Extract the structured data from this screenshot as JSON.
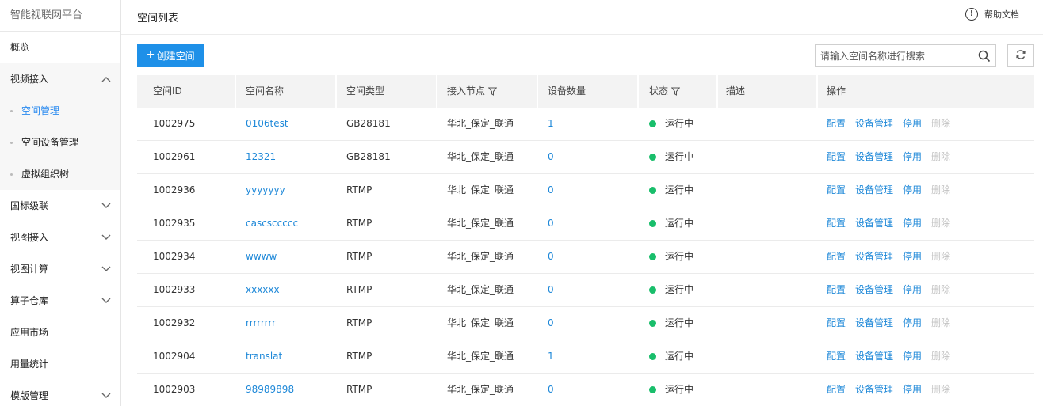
{
  "sidebar": {
    "brand": "智能视联网平台",
    "overview": "概览",
    "video_access": {
      "label": "视频接入",
      "children": [
        "空间管理",
        "空间设备管理",
        "虚拟组织树"
      ],
      "active_index": 0
    },
    "items": [
      {
        "label": "国标级联",
        "expandable": true
      },
      {
        "label": "视图接入",
        "expandable": true
      },
      {
        "label": "视图计算",
        "expandable": true
      },
      {
        "label": "算子仓库",
        "expandable": true
      },
      {
        "label": "应用市场",
        "expandable": false
      },
      {
        "label": "用量统计",
        "expandable": false
      },
      {
        "label": "模版管理",
        "expandable": true
      }
    ]
  },
  "header": {
    "title": "空间列表",
    "help_label": "帮助文档"
  },
  "toolbar": {
    "create_label": "创建空间",
    "search_placeholder": "请输入空间名称进行搜索"
  },
  "table": {
    "columns": [
      "空间ID",
      "空间名称",
      "空间类型",
      "接入节点",
      "设备数量",
      "状态",
      "描述",
      "操作"
    ],
    "filter_columns": [
      3,
      5
    ],
    "actions": [
      "配置",
      "设备管理",
      "停用",
      "删除"
    ],
    "rows": [
      {
        "id": "1002975",
        "name": "0106test",
        "type": "GB28181",
        "node": "华北_保定_联通",
        "devices": "1",
        "status": "运行中",
        "desc": ""
      },
      {
        "id": "1002961",
        "name": "12321",
        "type": "GB28181",
        "node": "华北_保定_联通",
        "devices": "0",
        "status": "运行中",
        "desc": ""
      },
      {
        "id": "1002936",
        "name": "yyyyyyy",
        "type": "RTMP",
        "node": "华北_保定_联通",
        "devices": "0",
        "status": "运行中",
        "desc": ""
      },
      {
        "id": "1002935",
        "name": "cascsccccc",
        "type": "RTMP",
        "node": "华北_保定_联通",
        "devices": "0",
        "status": "运行中",
        "desc": ""
      },
      {
        "id": "1002934",
        "name": "wwww",
        "type": "RTMP",
        "node": "华北_保定_联通",
        "devices": "0",
        "status": "运行中",
        "desc": ""
      },
      {
        "id": "1002933",
        "name": "xxxxxx",
        "type": "RTMP",
        "node": "华北_保定_联通",
        "devices": "0",
        "status": "运行中",
        "desc": ""
      },
      {
        "id": "1002932",
        "name": "rrrrrrrr",
        "type": "RTMP",
        "node": "华北_保定_联通",
        "devices": "0",
        "status": "运行中",
        "desc": ""
      },
      {
        "id": "1002904",
        "name": "translat",
        "type": "RTMP",
        "node": "华北_保定_联通",
        "devices": "1",
        "status": "运行中",
        "desc": ""
      },
      {
        "id": "1002903",
        "name": "98989898",
        "type": "RTMP",
        "node": "华北_保定_联通",
        "devices": "0",
        "status": "运行中",
        "desc": ""
      }
    ]
  },
  "colors": {
    "primary": "#1e90e8",
    "link": "#1e88d8",
    "status_running": "#19be6b",
    "disabled": "#c2c2c2"
  }
}
